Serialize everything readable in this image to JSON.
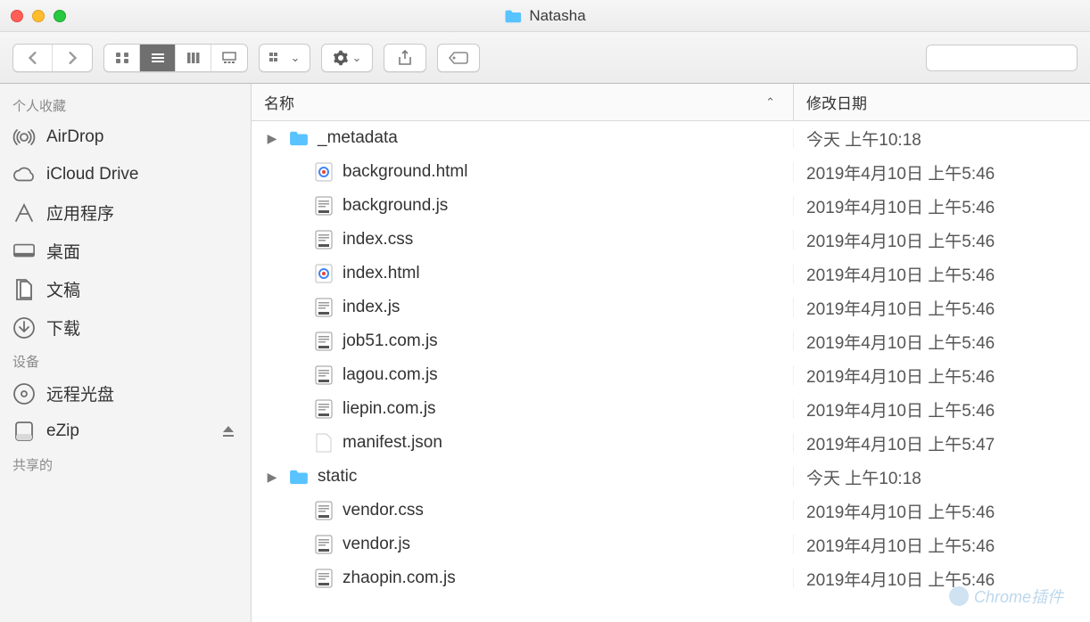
{
  "window": {
    "title": "Natasha"
  },
  "sidebar": {
    "sections": [
      {
        "header": "个人收藏",
        "items": [
          {
            "icon": "airdrop",
            "label": "AirDrop"
          },
          {
            "icon": "icloud",
            "label": "iCloud Drive"
          },
          {
            "icon": "apps",
            "label": "应用程序"
          },
          {
            "icon": "desktop",
            "label": "桌面"
          },
          {
            "icon": "docs",
            "label": "文稿"
          },
          {
            "icon": "downloads",
            "label": "下载"
          }
        ]
      },
      {
        "header": "设备",
        "items": [
          {
            "icon": "remotedisc",
            "label": "远程光盘"
          },
          {
            "icon": "disk",
            "label": "eZip",
            "eject": true
          }
        ]
      },
      {
        "header": "共享的",
        "items": []
      }
    ]
  },
  "columns": {
    "name": "名称",
    "date": "修改日期"
  },
  "files": [
    {
      "kind": "folder",
      "expandable": true,
      "name": "_metadata",
      "date": "今天 上午10:18"
    },
    {
      "kind": "html",
      "name": "background.html",
      "date": "2019年4月10日 上午5:46"
    },
    {
      "kind": "js",
      "name": "background.js",
      "date": "2019年4月10日 上午5:46"
    },
    {
      "kind": "css",
      "name": "index.css",
      "date": "2019年4月10日 上午5:46"
    },
    {
      "kind": "html",
      "name": "index.html",
      "date": "2019年4月10日 上午5:46"
    },
    {
      "kind": "js",
      "name": "index.js",
      "date": "2019年4月10日 上午5:46"
    },
    {
      "kind": "js",
      "name": "job51.com.js",
      "date": "2019年4月10日 上午5:46"
    },
    {
      "kind": "js",
      "name": "lagou.com.js",
      "date": "2019年4月10日 上午5:46"
    },
    {
      "kind": "js",
      "name": "liepin.com.js",
      "date": "2019年4月10日 上午5:46"
    },
    {
      "kind": "blank",
      "name": "manifest.json",
      "date": "2019年4月10日 上午5:47"
    },
    {
      "kind": "folder",
      "expandable": true,
      "name": "static",
      "date": "今天 上午10:18"
    },
    {
      "kind": "css",
      "name": "vendor.css",
      "date": "2019年4月10日 上午5:46"
    },
    {
      "kind": "js",
      "name": "vendor.js",
      "date": "2019年4月10日 上午5:46"
    },
    {
      "kind": "js",
      "name": "zhaopin.com.js",
      "date": "2019年4月10日 上午5:46"
    }
  ],
  "watermark": "Chrome插件"
}
